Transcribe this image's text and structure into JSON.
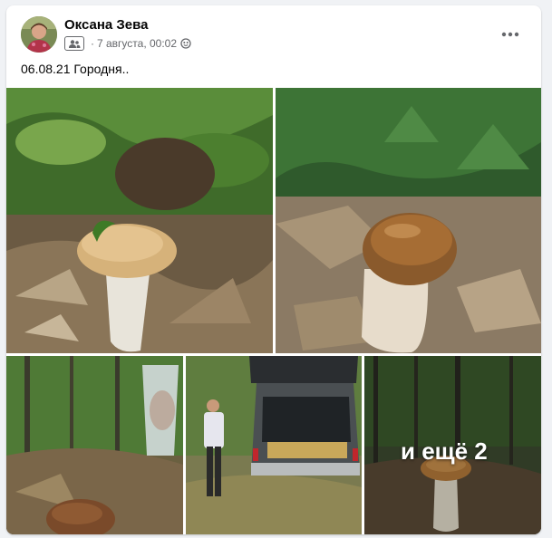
{
  "post": {
    "author": "Оксана Зева",
    "date": "7 августа, 00:02",
    "separator": "·",
    "text": "06.08.21 Городня..",
    "more_photos_label": "и ещё 2"
  },
  "icons": {
    "avatar": "avatar-photo",
    "group": "group-badge-icon",
    "privacy": "globe-icon",
    "menu": "more-options-icon"
  },
  "colors": {
    "background": "#f0f2f5",
    "card": "#ffffff",
    "author_text": "#050505",
    "meta_text": "#65676b"
  }
}
